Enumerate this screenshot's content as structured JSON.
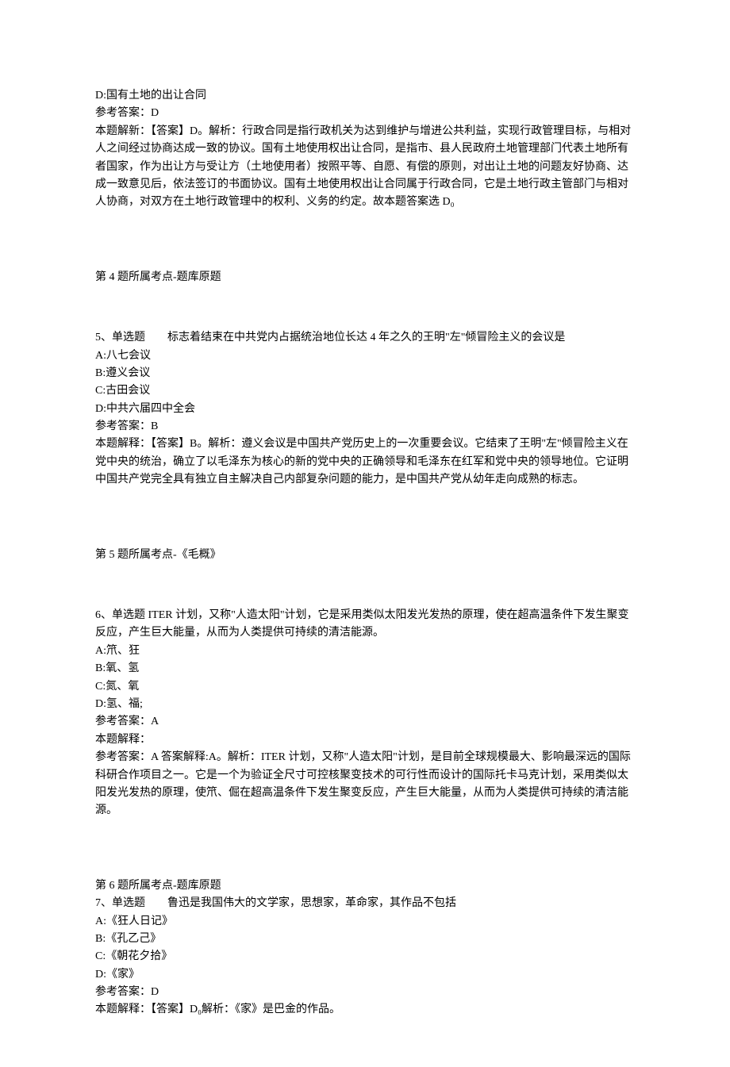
{
  "q4_continuation": {
    "option_d": "D:国有土地的出让合同",
    "ref_answer_label": "参考答案：D",
    "explanation": "本题解新：【答案】D。解析：行政合同是指行政机关为达到维护与增进公共利益，实现行政管理目标，与相对人之间经过协商达成一致的协议。国有土地使用权出让合同，是指市、县人民政府土地管理部门代表土地所有者国家，作为出让方与受让方（土地使用者）按照平等、自愿、有偿的原则，对出让土地的问题友好协商、达成一致意见后，依法签订的书面协议。国有土地使用权出让合同属于行政合同，它是土地行政主管部门与相对人协商，对双方在土地行政管理中的权利、义务的约定。故本题答案选 D₀",
    "category": "第 4 题所属考点-题库原题"
  },
  "q5": {
    "header": "5、单选题　　标志着结束在中共党内占据统治地位长达 4 年之久的王明\"左\"倾冒险主义的会议是",
    "option_a": "A:八七会议",
    "option_b": "B:遵义会议",
    "option_c": "C:古田会议",
    "option_d": "D:中共六届四中全会",
    "ref_answer_label": "参考答案：B",
    "explanation": "本题解释：【答案】B。解析：遵义会议是中国共产党历史上的一次重要会议。它结束了王明\"左\"倾冒险主义在党中央的统治，确立了以毛泽东为核心的新的党中央的正确领导和毛泽东在红军和党中央的领导地位。它证明中国共产党完全具有独立自主解决自己内部复杂问题的能力，是中国共产党从幼年走向成熟的标志。",
    "category": "第 5 题所属考点-《毛概》"
  },
  "q6": {
    "header": "6、单选题 ITER 计划，又称\"人造太阳\"计划，它是采用类似太阳发光发热的原理，使在超高温条件下发生聚变反应，产生巨大能量，从而为人类提供可持续的清洁能源。",
    "option_a": "A:笊、狂",
    "option_b": "B:氧、氢",
    "option_c": "C:氮、氧",
    "option_d": "D:氢、福;",
    "ref_answer_label": "参考答案：A",
    "explanation_label": "本题解释：",
    "explanation": "参考答案：A 答案解释:A。解析：ITER 计划，又称\"人造太阳\"计划，是目前全球规模最大、影响最深远的国际科研合作项目之一。它是一个为验证全尺寸可控核聚变技术的可行性而设计的国际托卡马克计划，采用类似太阳发光发热的原理，使笊、倔在超高温条件下发生聚变反应，产生巨大能量，从而为人类提供可持续的清洁能源。",
    "category": "第 6 题所属考点-题库原题"
  },
  "q7": {
    "header": "7、单选题　　鲁迅是我国伟大的文学家，思想家，革命家，其作品不包括",
    "option_a": "A:《狂人日记》",
    "option_b": "B:《孔乙己》",
    "option_c": "C:《朝花夕拾》",
    "option_d": "D:《家》",
    "ref_answer_label": "参考答案：D",
    "explanation": "本题解释：【答案】D₀解析：《家》是巴金的作品。"
  }
}
